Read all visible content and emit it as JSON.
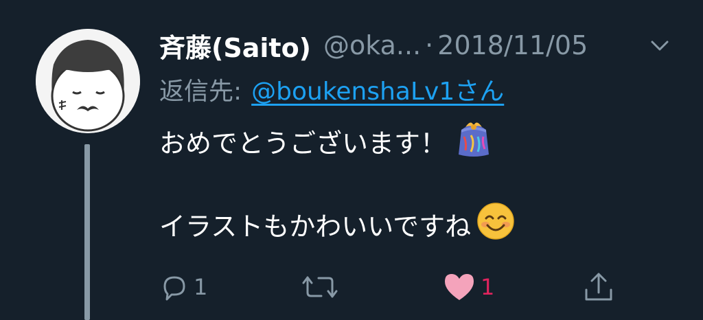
{
  "tweet": {
    "display_name": "斉藤(Saito)",
    "handle": "@oka...",
    "separator": "·",
    "date": "2018/11/05",
    "reply_label": "返信先:",
    "reply_mention": "@boukenshaLv1さん",
    "lines": [
      "おめでとうございます！",
      "イラストもかわいいですね"
    ],
    "emojis": [
      "party-popper-emoji",
      "smiling-face-emoji"
    ]
  },
  "actions": {
    "reply_count": "1",
    "retweet_count": "",
    "like_count": "1",
    "liked": true
  },
  "colors": {
    "background": "#15202b",
    "primary_text": "#ffffff",
    "secondary_text": "#8899a6",
    "link": "#1da1f2",
    "like": "#e0245e",
    "like_heart_fill": "#f4a3bb"
  }
}
